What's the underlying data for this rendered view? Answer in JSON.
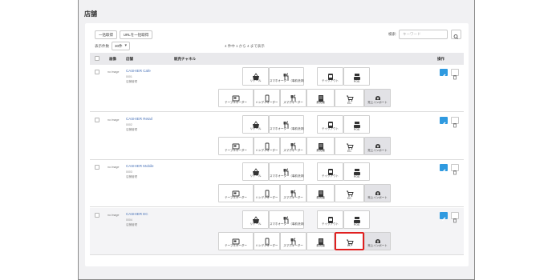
{
  "page": {
    "title": "店舗"
  },
  "toolbar": {
    "bulk_get_label": "一括取得",
    "url_bulk_get_label": "URLを一括取得",
    "per_page_label": "表示件数",
    "per_page_value": "30件"
  },
  "search": {
    "label": "検索:",
    "placeholder": "キーワード"
  },
  "result_count": "4 件中 1 から 4 まで表示",
  "table": {
    "headers": {
      "image": "画像",
      "store": "店舗",
      "channel": "販売チャネル",
      "action": "操作"
    },
    "rows": [
      {
        "image_text": "no image",
        "name": "CASHIER Cafe",
        "sub1": "0001",
        "sub2": "店舗管理"
      },
      {
        "image_text": "no image",
        "name": "CASHIER Retail",
        "sub1": "0002",
        "sub2": "店舗管理"
      },
      {
        "image_text": "no image",
        "name": "CASHIER Mobile",
        "sub1": "0003",
        "sub2": "店舗管理"
      },
      {
        "image_text": "no image",
        "name": "CASHIER EC",
        "sub1": "0004",
        "sub2": "店舗管理"
      }
    ]
  },
  "channels": {
    "order": "リテール",
    "smart_order": "スマホオーダー（事前決済）",
    "takeout": "テイクアウト",
    "pos": "POS",
    "table_order": "テーブルオーダー",
    "handy_order": "ハンディオーダー",
    "smart_order2": "スマホオーダー",
    "ticket": "券売機",
    "ec": "EC",
    "sales_import": "売上インポート"
  },
  "colors": {
    "accent": "#2f9ae0",
    "highlight": "#e02020",
    "link": "#4a73b8"
  },
  "icons": {
    "edit": "edit-icon",
    "delete": "trash-icon",
    "search": "search-icon"
  }
}
